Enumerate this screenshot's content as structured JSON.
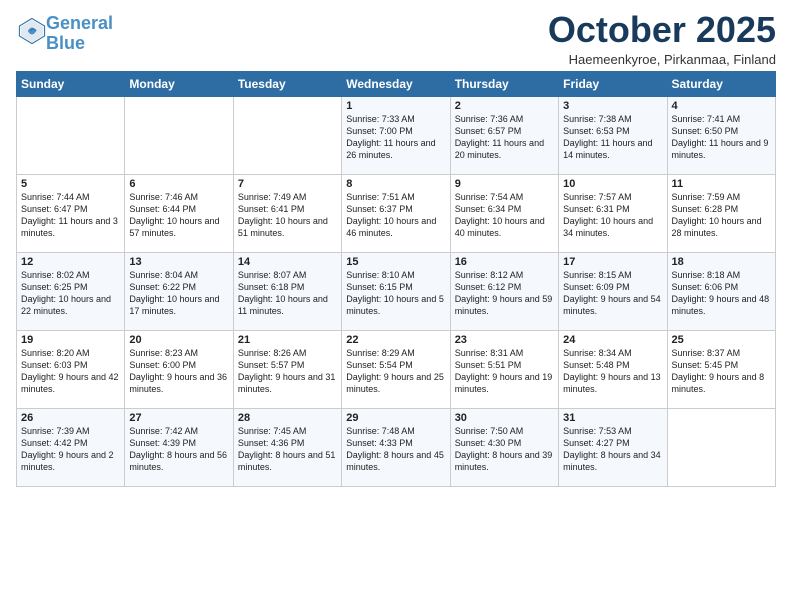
{
  "logo": {
    "line1": "General",
    "line2": "Blue"
  },
  "header": {
    "month": "October 2025",
    "location": "Haemeenkyroe, Pirkanmaa, Finland"
  },
  "weekdays": [
    "Sunday",
    "Monday",
    "Tuesday",
    "Wednesday",
    "Thursday",
    "Friday",
    "Saturday"
  ],
  "weeks": [
    [
      {
        "day": "",
        "info": ""
      },
      {
        "day": "",
        "info": ""
      },
      {
        "day": "",
        "info": ""
      },
      {
        "day": "1",
        "info": "Sunrise: 7:33 AM\nSunset: 7:00 PM\nDaylight: 11 hours\nand 26 minutes."
      },
      {
        "day": "2",
        "info": "Sunrise: 7:36 AM\nSunset: 6:57 PM\nDaylight: 11 hours\nand 20 minutes."
      },
      {
        "day": "3",
        "info": "Sunrise: 7:38 AM\nSunset: 6:53 PM\nDaylight: 11 hours\nand 14 minutes."
      },
      {
        "day": "4",
        "info": "Sunrise: 7:41 AM\nSunset: 6:50 PM\nDaylight: 11 hours\nand 9 minutes."
      }
    ],
    [
      {
        "day": "5",
        "info": "Sunrise: 7:44 AM\nSunset: 6:47 PM\nDaylight: 11 hours\nand 3 minutes."
      },
      {
        "day": "6",
        "info": "Sunrise: 7:46 AM\nSunset: 6:44 PM\nDaylight: 10 hours\nand 57 minutes."
      },
      {
        "day": "7",
        "info": "Sunrise: 7:49 AM\nSunset: 6:41 PM\nDaylight: 10 hours\nand 51 minutes."
      },
      {
        "day": "8",
        "info": "Sunrise: 7:51 AM\nSunset: 6:37 PM\nDaylight: 10 hours\nand 46 minutes."
      },
      {
        "day": "9",
        "info": "Sunrise: 7:54 AM\nSunset: 6:34 PM\nDaylight: 10 hours\nand 40 minutes."
      },
      {
        "day": "10",
        "info": "Sunrise: 7:57 AM\nSunset: 6:31 PM\nDaylight: 10 hours\nand 34 minutes."
      },
      {
        "day": "11",
        "info": "Sunrise: 7:59 AM\nSunset: 6:28 PM\nDaylight: 10 hours\nand 28 minutes."
      }
    ],
    [
      {
        "day": "12",
        "info": "Sunrise: 8:02 AM\nSunset: 6:25 PM\nDaylight: 10 hours\nand 22 minutes."
      },
      {
        "day": "13",
        "info": "Sunrise: 8:04 AM\nSunset: 6:22 PM\nDaylight: 10 hours\nand 17 minutes."
      },
      {
        "day": "14",
        "info": "Sunrise: 8:07 AM\nSunset: 6:18 PM\nDaylight: 10 hours\nand 11 minutes."
      },
      {
        "day": "15",
        "info": "Sunrise: 8:10 AM\nSunset: 6:15 PM\nDaylight: 10 hours\nand 5 minutes."
      },
      {
        "day": "16",
        "info": "Sunrise: 8:12 AM\nSunset: 6:12 PM\nDaylight: 9 hours\nand 59 minutes."
      },
      {
        "day": "17",
        "info": "Sunrise: 8:15 AM\nSunset: 6:09 PM\nDaylight: 9 hours\nand 54 minutes."
      },
      {
        "day": "18",
        "info": "Sunrise: 8:18 AM\nSunset: 6:06 PM\nDaylight: 9 hours\nand 48 minutes."
      }
    ],
    [
      {
        "day": "19",
        "info": "Sunrise: 8:20 AM\nSunset: 6:03 PM\nDaylight: 9 hours\nand 42 minutes."
      },
      {
        "day": "20",
        "info": "Sunrise: 8:23 AM\nSunset: 6:00 PM\nDaylight: 9 hours\nand 36 minutes."
      },
      {
        "day": "21",
        "info": "Sunrise: 8:26 AM\nSunset: 5:57 PM\nDaylight: 9 hours\nand 31 minutes."
      },
      {
        "day": "22",
        "info": "Sunrise: 8:29 AM\nSunset: 5:54 PM\nDaylight: 9 hours\nand 25 minutes."
      },
      {
        "day": "23",
        "info": "Sunrise: 8:31 AM\nSunset: 5:51 PM\nDaylight: 9 hours\nand 19 minutes."
      },
      {
        "day": "24",
        "info": "Sunrise: 8:34 AM\nSunset: 5:48 PM\nDaylight: 9 hours\nand 13 minutes."
      },
      {
        "day": "25",
        "info": "Sunrise: 8:37 AM\nSunset: 5:45 PM\nDaylight: 9 hours\nand 8 minutes."
      }
    ],
    [
      {
        "day": "26",
        "info": "Sunrise: 7:39 AM\nSunset: 4:42 PM\nDaylight: 9 hours\nand 2 minutes."
      },
      {
        "day": "27",
        "info": "Sunrise: 7:42 AM\nSunset: 4:39 PM\nDaylight: 8 hours\nand 56 minutes."
      },
      {
        "day": "28",
        "info": "Sunrise: 7:45 AM\nSunset: 4:36 PM\nDaylight: 8 hours\nand 51 minutes."
      },
      {
        "day": "29",
        "info": "Sunrise: 7:48 AM\nSunset: 4:33 PM\nDaylight: 8 hours\nand 45 minutes."
      },
      {
        "day": "30",
        "info": "Sunrise: 7:50 AM\nSunset: 4:30 PM\nDaylight: 8 hours\nand 39 minutes."
      },
      {
        "day": "31",
        "info": "Sunrise: 7:53 AM\nSunset: 4:27 PM\nDaylight: 8 hours\nand 34 minutes."
      },
      {
        "day": "",
        "info": ""
      }
    ]
  ]
}
